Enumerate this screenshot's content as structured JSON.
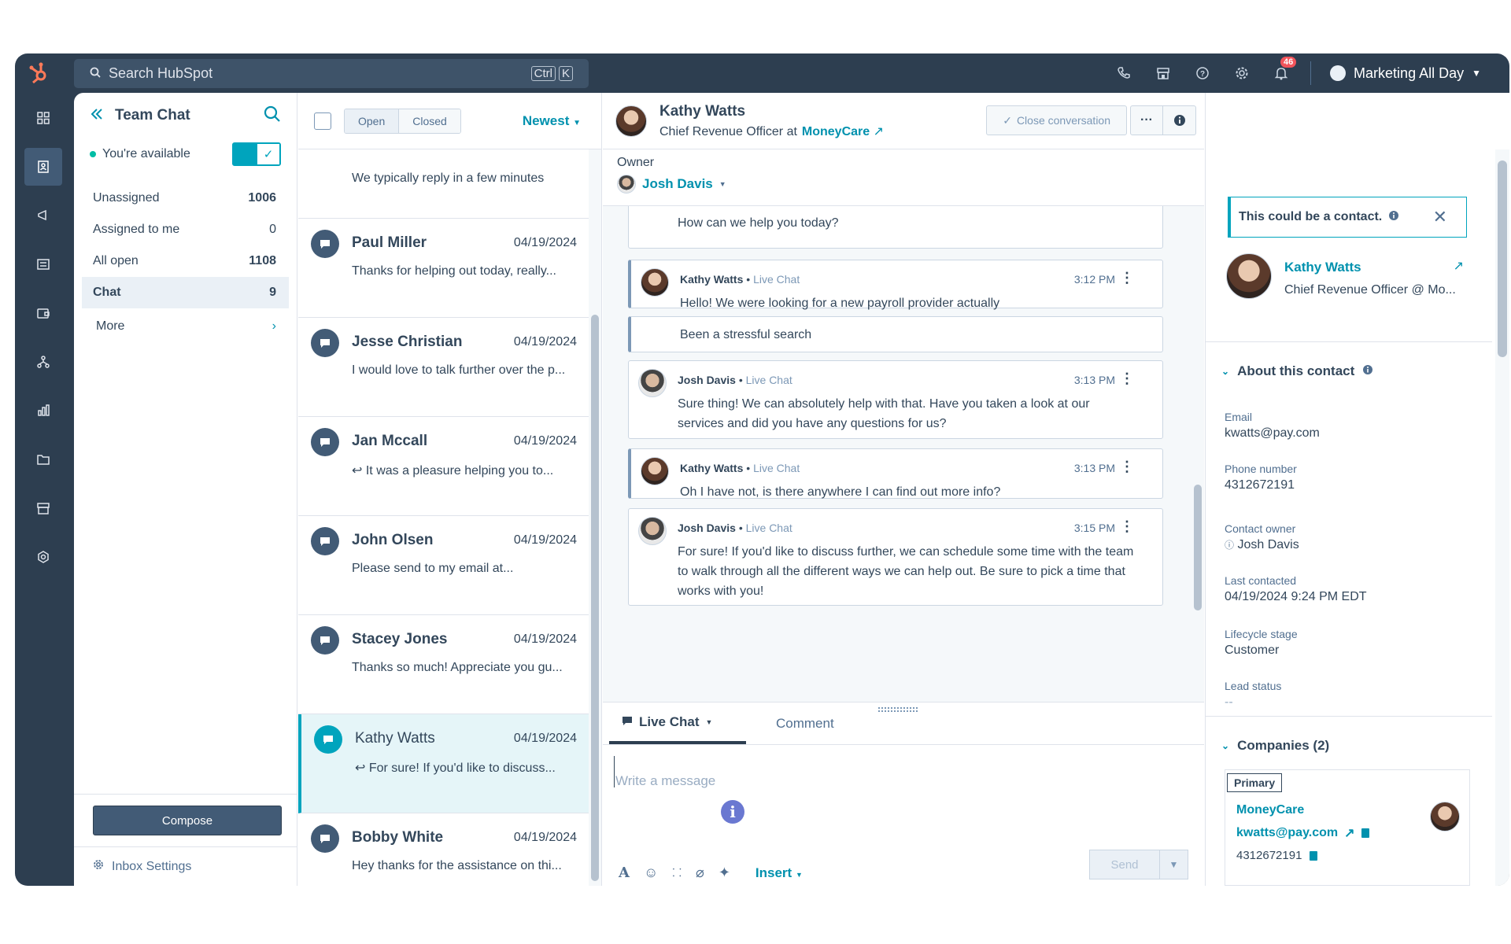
{
  "colors": {
    "nav": "#2d3e50",
    "accent": "#0091ae",
    "teal": "#00a4bd",
    "badge": "#f2545b"
  },
  "topbar": {
    "search_placeholder": "Search HubSpot",
    "kbd": [
      "Ctrl",
      "K"
    ],
    "notification_count": "46",
    "account_name": "Marketing All Day"
  },
  "inbox": {
    "title": "Team Chat",
    "availability": "You're available",
    "filters": [
      {
        "label": "Unassigned",
        "count": "1006"
      },
      {
        "label": "Assigned to me",
        "count": "0"
      },
      {
        "label": "All open",
        "count": "1108"
      },
      {
        "label": "Chat",
        "count": "9"
      }
    ],
    "more": "More",
    "compose": "Compose",
    "settings": "Inbox Settings"
  },
  "convlist": {
    "tabs": [
      "Open",
      "Closed"
    ],
    "sort": "Newest",
    "partial_preview": "We typically reply in a few minutes",
    "items": [
      {
        "name": "Paul Miller",
        "date": "04/19/2024",
        "preview": "Thanks for helping out today, really..."
      },
      {
        "name": "Jesse Christian",
        "date": "04/19/2024",
        "preview": "I would love to talk further over the p..."
      },
      {
        "name": "Jan Mccall",
        "date": "04/19/2024",
        "preview": "↩ It was a pleasure helping you to..."
      },
      {
        "name": "John Olsen",
        "date": "04/19/2024",
        "preview": "Please send to my email at..."
      },
      {
        "name": "Stacey Jones",
        "date": "04/19/2024",
        "preview": "Thanks so much! Appreciate you gu..."
      },
      {
        "name": "Kathy Watts",
        "date": "04/19/2024",
        "preview": "↩ For sure! If you'd like to discuss..."
      },
      {
        "name": "Bobby White",
        "date": "04/19/2024",
        "preview": "Hey thanks for the assistance on thi..."
      }
    ]
  },
  "conversation": {
    "contact_name": "Kathy Watts",
    "contact_title": "Chief Revenue Officer at",
    "company": "MoneyCare",
    "close_label": "Close conversation",
    "owner_label": "Owner",
    "owner_name": "Josh Davis",
    "messages": [
      {
        "author": "",
        "channel": "",
        "time": "",
        "body": "How can we help you today?"
      },
      {
        "author": "Kathy Watts",
        "channel": "Live Chat",
        "time": "3:12 PM",
        "body": "Hello! We were looking for a new payroll provider actually"
      },
      {
        "author": "",
        "channel": "",
        "time": "",
        "body": "Been a stressful search"
      },
      {
        "author": "Josh Davis",
        "channel": "Live Chat",
        "time": "3:13 PM",
        "body": "Sure thing! We can absolutely help with that. Have you taken a look at our services and did you have any questions for us?"
      },
      {
        "author": "Kathy Watts",
        "channel": "Live Chat",
        "time": "3:13 PM",
        "body": "Oh I have not, is there anywhere I can find out more info?"
      },
      {
        "author": "Josh Davis",
        "channel": "Live Chat",
        "time": "3:15 PM",
        "body": "For sure! If you'd like to discuss further, we can schedule some time with the team to walk through all the different ways we can help out. Be sure to pick a time that works with you!"
      }
    ],
    "composer": {
      "tab_live": "Live Chat",
      "tab_comment": "Comment",
      "placeholder": "Write a message",
      "insert": "Insert",
      "send": "Send"
    }
  },
  "sidebar": {
    "suggest": "This could be a contact.",
    "card_name": "Kathy Watts",
    "card_sub": "Chief Revenue Officer @ Mo...",
    "about_title": "About this contact",
    "props": [
      {
        "label": "Email",
        "value": "kwatts@pay.com"
      },
      {
        "label": "Phone number",
        "value": "4312672191"
      },
      {
        "label": "Contact owner",
        "value": "Josh Davis"
      },
      {
        "label": "Last contacted",
        "value": "04/19/2024 9:24 PM EDT"
      },
      {
        "label": "Lifecycle stage",
        "value": "Customer"
      },
      {
        "label": "Lead status",
        "value": "--"
      }
    ],
    "companies_title": "Companies (2)",
    "primary_tag": "Primary",
    "company_name": "MoneyCare",
    "company_email": "kwatts@pay.com",
    "company_phone": "4312672191"
  }
}
